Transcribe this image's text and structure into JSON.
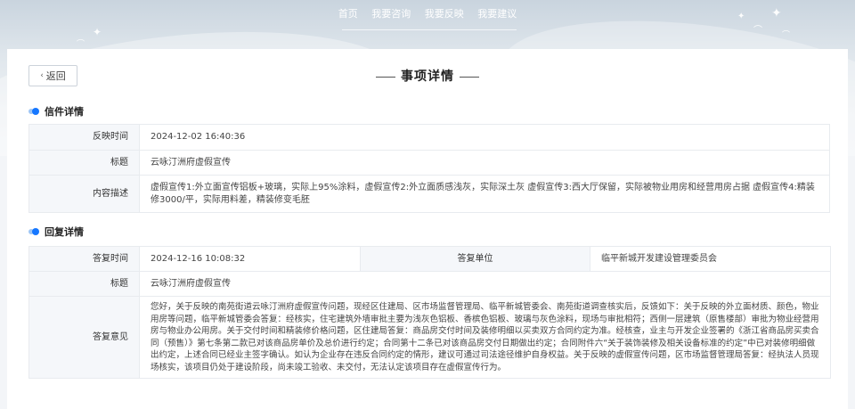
{
  "nav": {
    "items": [
      "首页",
      "我要咨询",
      "我要反映",
      "我要建议"
    ]
  },
  "page": {
    "back_label": "返回",
    "title": "事项详情"
  },
  "letter": {
    "section_title": "信件详情",
    "rows": [
      {
        "label": "反映时间",
        "value": "2024-12-02 16:40:36"
      },
      {
        "label": "标题",
        "value": "云咏汀洲府虚假宣传"
      },
      {
        "label": "内容描述",
        "value": "虚假宣传1:外立面宣传铝板+玻璃，实际上95%涂料，虚假宣传2:外立面质感浅灰，实际深土灰 虚假宣传3:西大厅保留，实际被物业用房和经营用房占据 虚假宣传4:精装修3000/平，实际用料差，精装修变毛胚"
      }
    ]
  },
  "reply": {
    "section_title": "回复详情",
    "time_label": "答复时间",
    "time_value": "2024-12-16 10:08:32",
    "unit_label": "答复单位",
    "unit_value": "临平新城开发建设管理委员会",
    "title_label": "标题",
    "title_value": "云咏汀洲府虚假宣传",
    "opinion_label": "答复意见",
    "opinion_value": "您好，关于反映的南苑街道云咏汀洲府虚假宣传问题，现经区住建局、区市场监督管理局、临平新城管委会、南苑街道调查核实后，反馈如下：关于反映的外立面材质、颜色，物业用房等问题，临平新城管委会答复：经核实，住宅建筑外墙审批主要为浅灰色铝板、香槟色铝板、玻璃与灰色涂料，现场与审批相符；西侧一层建筑（原售楼部）审批为物业经营用房与物业办公用房。关于交付时间和精装修价格问题，区住建局答复：商品房交付时间及装修明细以买卖双方合同约定为准。经核查，业主与开发企业签署的《浙江省商品房买卖合同（预售）》第七条第二款已对该商品房单价及总价进行约定；合同第十二条已对该商品房交付日期做出约定；合同附件六“关于装饰装修及相关设备标准的约定”中已对装修明细做出约定，上述合同已经业主签字确认。如认为企业存在违反合同约定的情形，建议可通过司法途径维护自身权益。关于反映的虚假宣传问题，区市场监督管理局答复：经执法人员现场核实，该项目仍处于建设阶段，尚未竣工验收、未交付，无法认定该项目存在虚假宣传行为。"
  }
}
